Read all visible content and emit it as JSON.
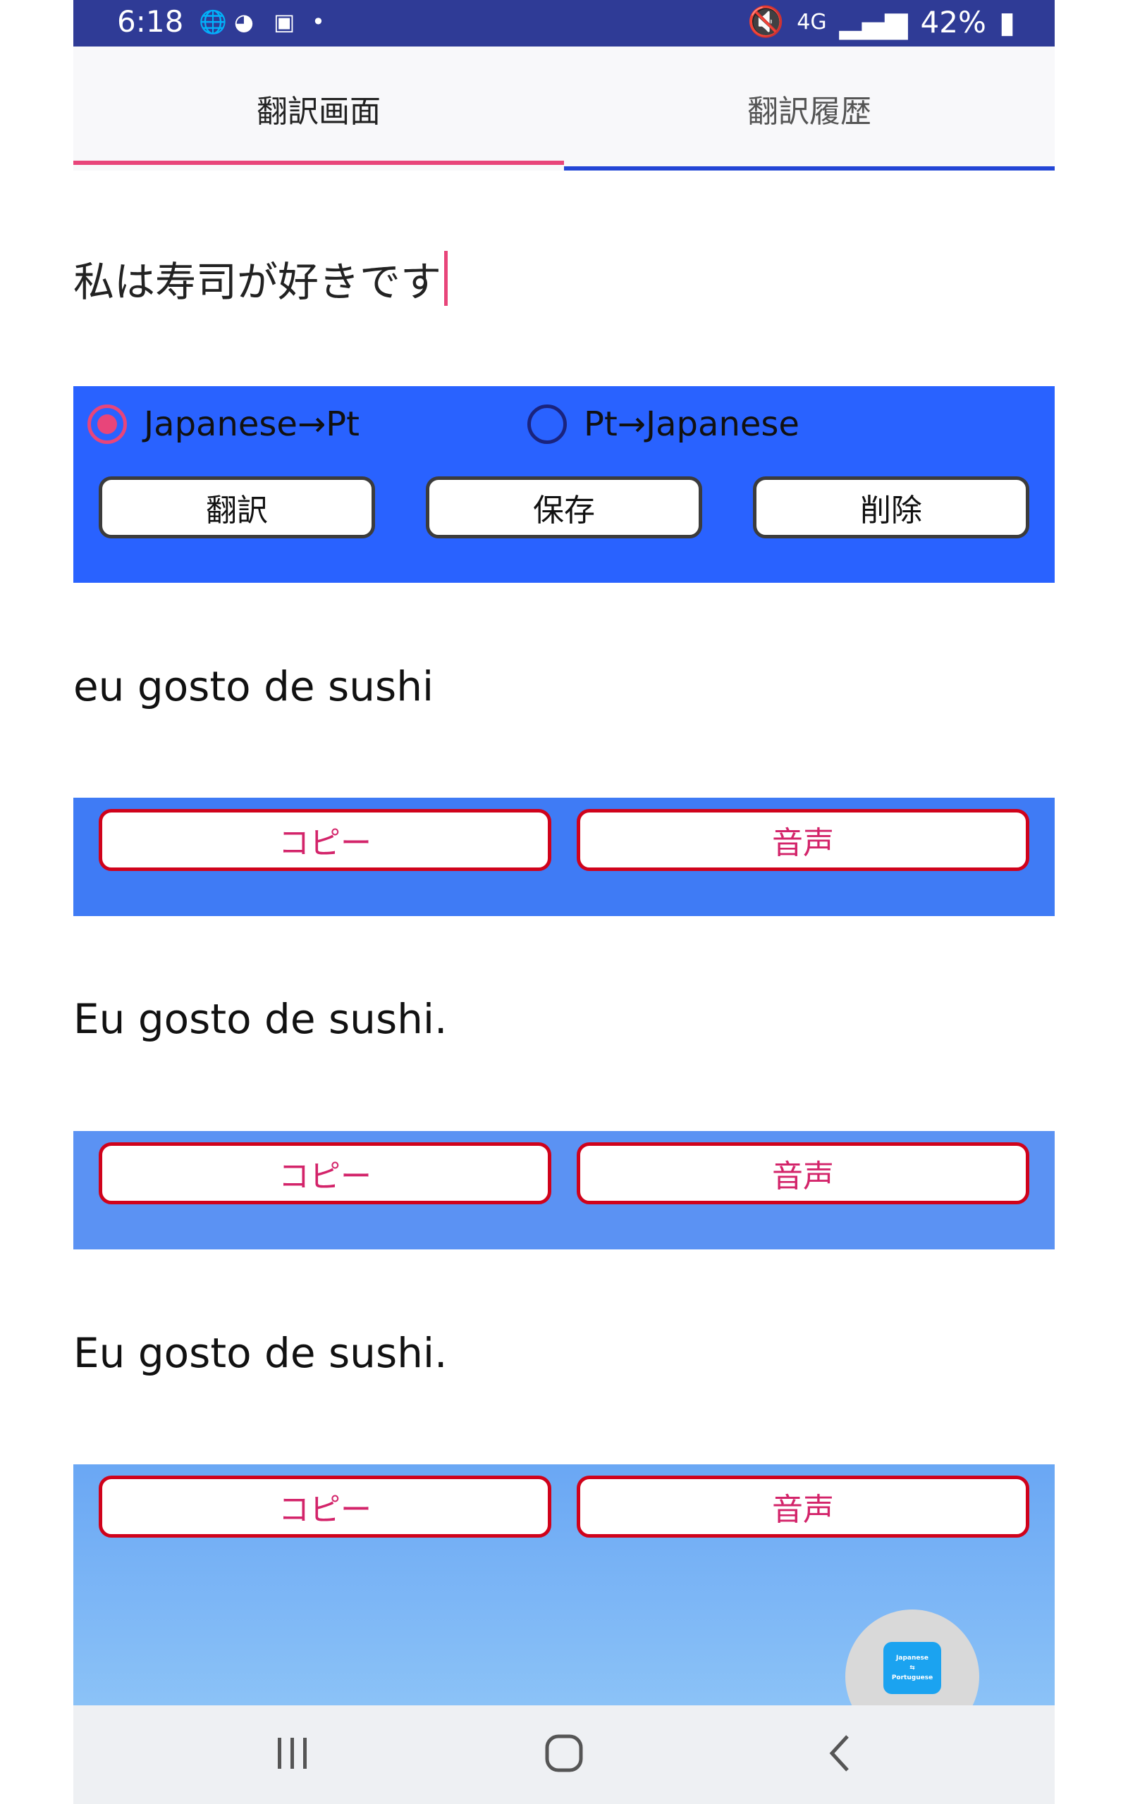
{
  "status_bar": {
    "time": "6:18",
    "network": "4G",
    "battery": "42%"
  },
  "tabs": [
    {
      "label": "翻訳画面",
      "active": true
    },
    {
      "label": "翻訳履歴",
      "active": false
    }
  ],
  "input": {
    "text": "私は寿司が好きです"
  },
  "direction": {
    "options": [
      {
        "label": "Japanese→Pt",
        "selected": true
      },
      {
        "label": "Pt→Japanese",
        "selected": false
      }
    ]
  },
  "actions": {
    "translate": "翻訳",
    "save": "保存",
    "delete": "削除"
  },
  "results": [
    {
      "text": "eu gosto de sushi",
      "copy_label": "コピー",
      "speech_label": "音声"
    },
    {
      "text": "Eu gosto de sushi.",
      "copy_label": "コピー",
      "speech_label": "音声"
    },
    {
      "text": "Eu gosto de sushi.",
      "copy_label": "コピー",
      "speech_label": "音声"
    }
  ],
  "fab": {
    "line1": "Japanese",
    "line2": "⇆",
    "line3": "Portuguese"
  },
  "colors": {
    "status_bar": "#2f3b96",
    "accent_pink": "#e8457a",
    "panel_blue": "#2962ff",
    "button_red_border": "#d0021b",
    "button_red_text": "#d3246a"
  }
}
